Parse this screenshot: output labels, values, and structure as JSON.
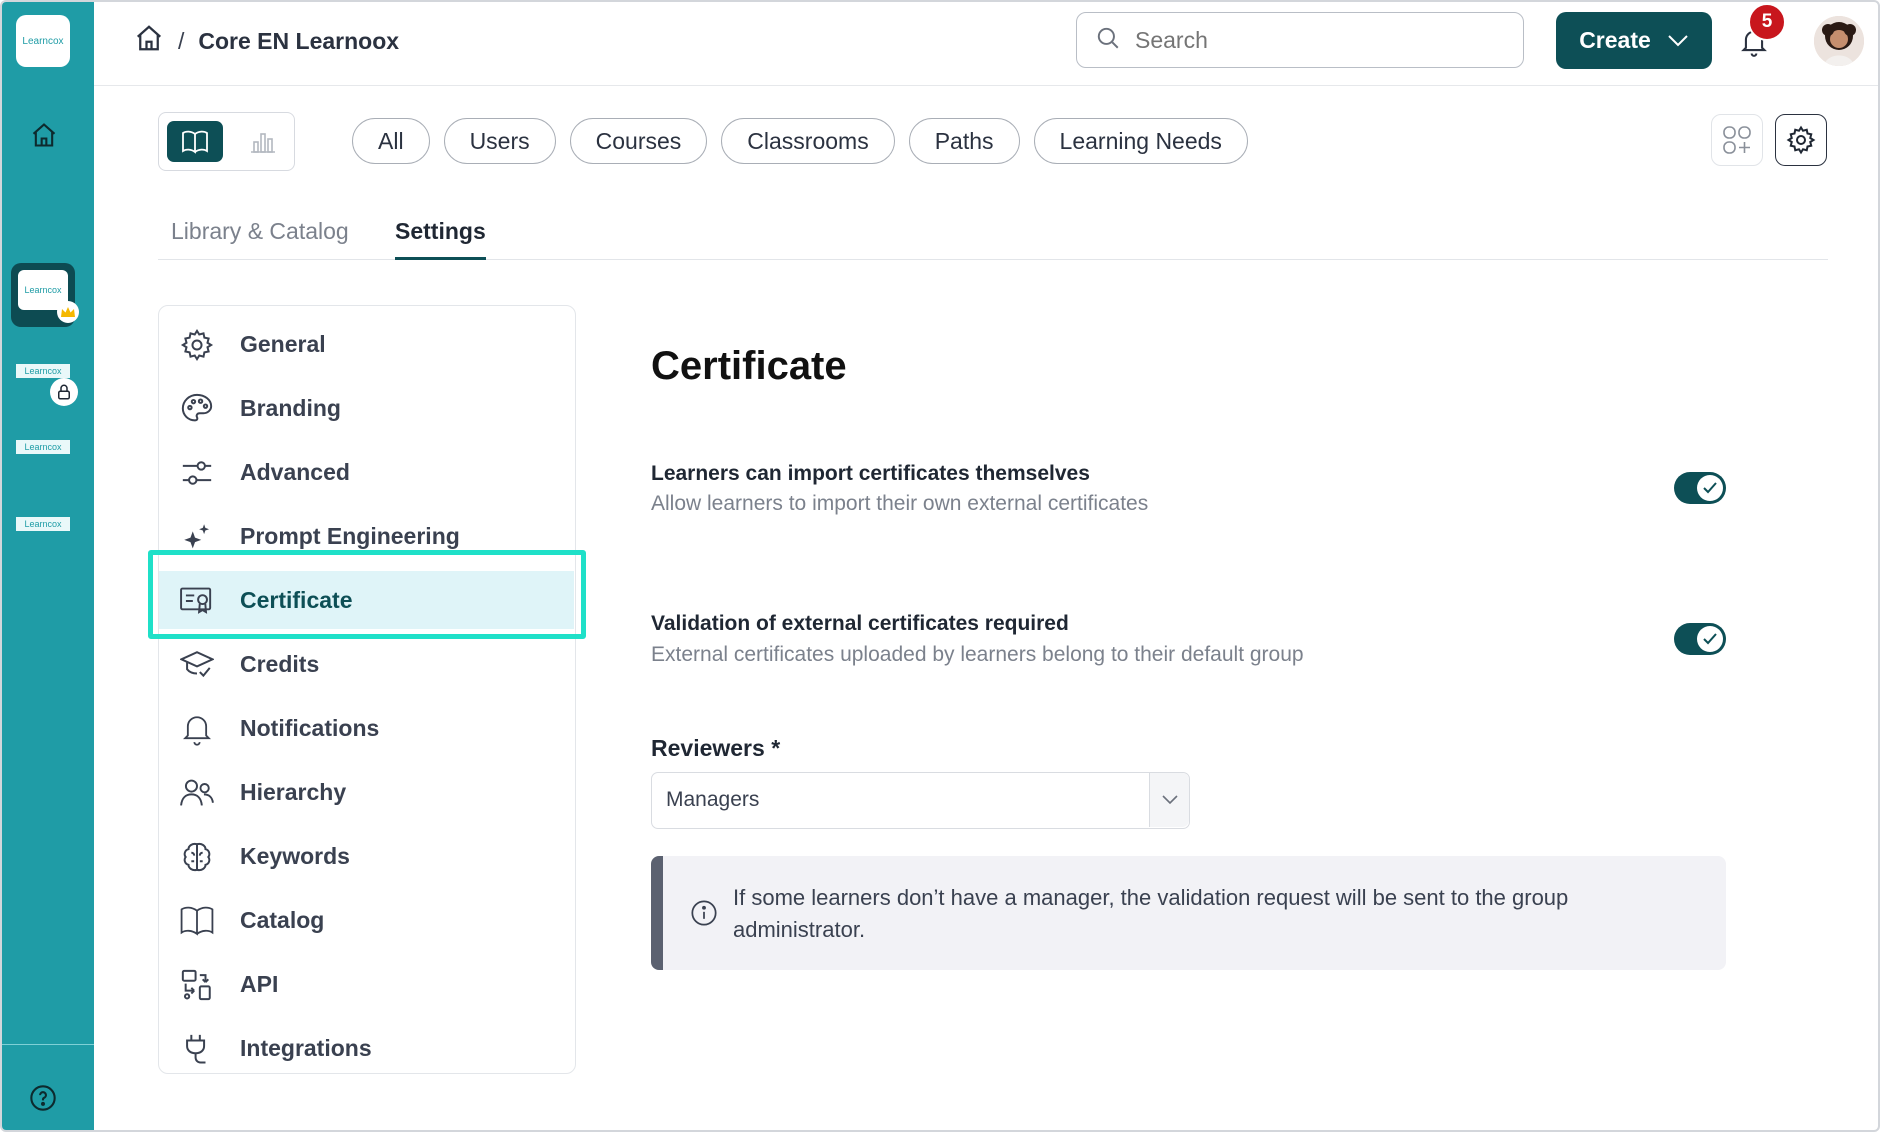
{
  "rail": {
    "logo_label": "Learncox",
    "apps": [
      {
        "label": "Learncox"
      },
      {
        "label": "Learncox"
      },
      {
        "label": "Learncox"
      },
      {
        "label": "Learncox"
      }
    ]
  },
  "topbar": {
    "breadcrumb_sep": "/",
    "breadcrumb_title": "Core EN Learnoox",
    "search_placeholder": "Search",
    "create_label": "Create",
    "notification_count": "5"
  },
  "filters": [
    "All",
    "Users",
    "Courses",
    "Classrooms",
    "Paths",
    "Learning Needs"
  ],
  "tabs": {
    "library": "Library & Catalog",
    "settings": "Settings"
  },
  "sidebar": {
    "items": [
      {
        "label": "General",
        "icon": "gear-icon"
      },
      {
        "label": "Branding",
        "icon": "palette-icon"
      },
      {
        "label": "Advanced",
        "icon": "sliders-icon"
      },
      {
        "label": "Prompt Engineering",
        "icon": "sparkle-icon"
      },
      {
        "label": "Certificate",
        "icon": "certificate-icon"
      },
      {
        "label": "Credits",
        "icon": "graduation-cap-icon"
      },
      {
        "label": "Notifications",
        "icon": "bell-icon"
      },
      {
        "label": "Hierarchy",
        "icon": "users-icon"
      },
      {
        "label": "Keywords",
        "icon": "brain-icon"
      },
      {
        "label": "Catalog",
        "icon": "book-icon"
      },
      {
        "label": "API",
        "icon": "api-icon"
      },
      {
        "label": "Integrations",
        "icon": "plug-icon"
      }
    ],
    "active_index": 4
  },
  "main": {
    "title": "Certificate",
    "option1": {
      "title": "Learners can import certificates themselves",
      "desc": "Allow learners to import their own external certificates",
      "enabled": true
    },
    "option2": {
      "title": "Validation of external certificates required",
      "desc": "External certificates uploaded by learners belong to their default group",
      "enabled": true
    },
    "reviewers_label": "Reviewers *",
    "reviewers_value": "Managers",
    "info_text": "If some learners don’t have a manager, the validation request will be sent to the group administrator."
  },
  "colors": {
    "rail": "#1f9ca6",
    "primary": "#0d4f56",
    "badge": "#c8161d",
    "highlight": "#1fe0c8",
    "active_bg": "#dff4f8"
  }
}
